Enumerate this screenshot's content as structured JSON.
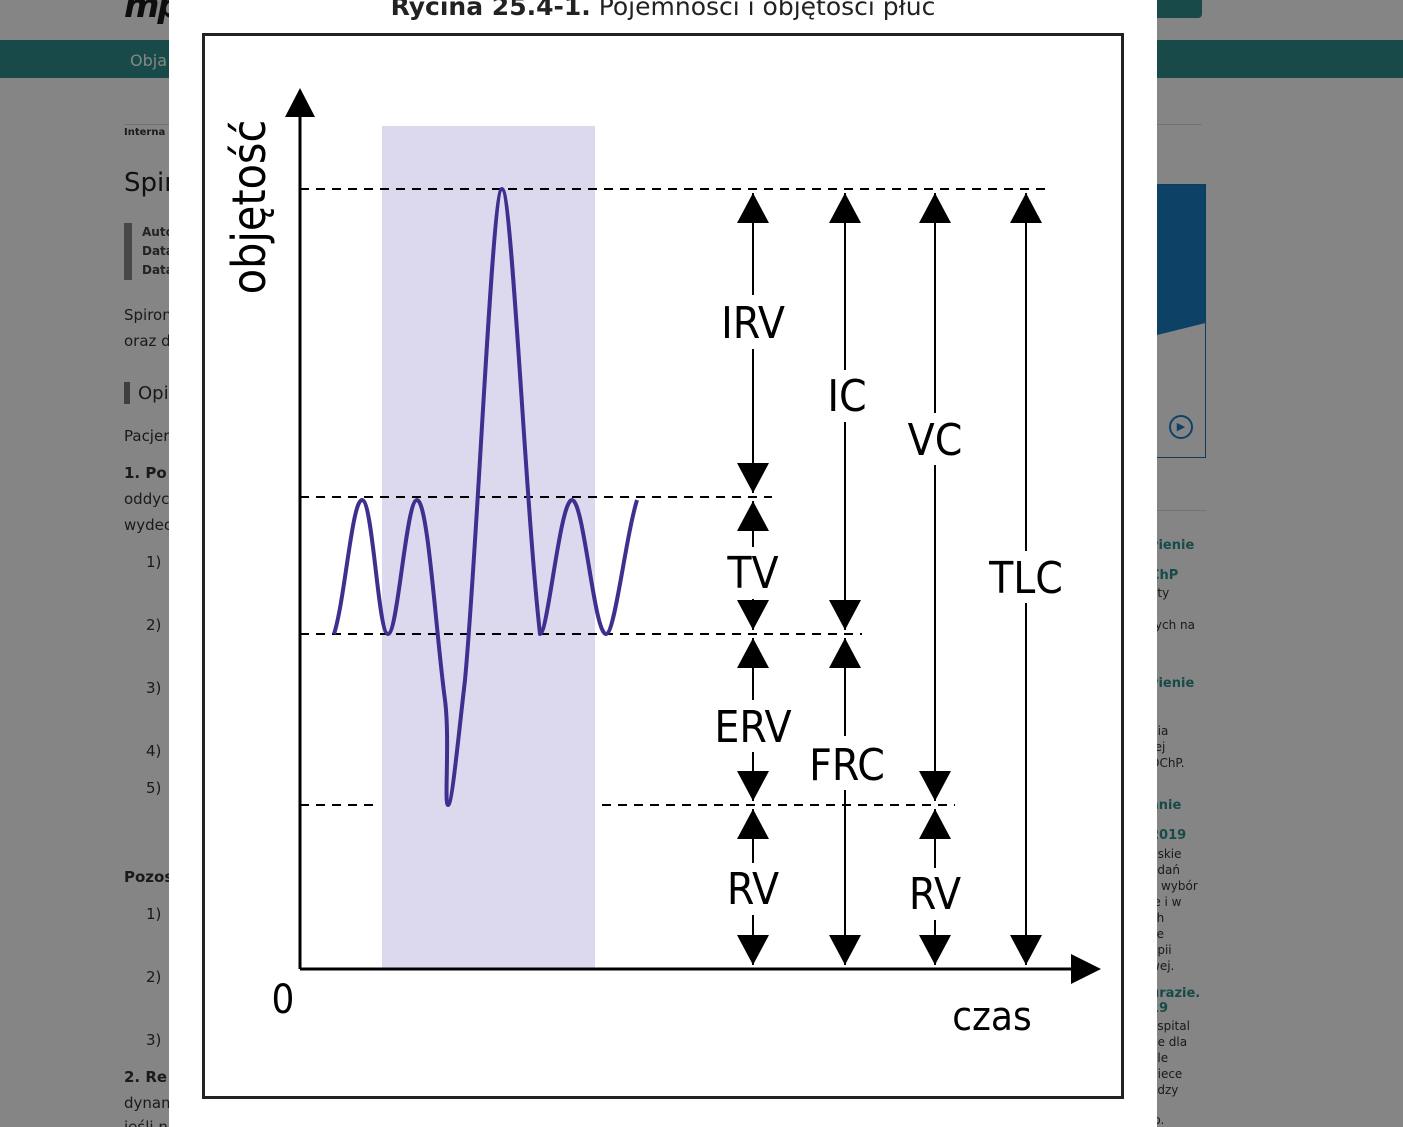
{
  "background_page": {
    "nav": {
      "item": "Obja"
    },
    "breadcrumb": "Interna",
    "title": "Spir",
    "meta": [
      "Auto",
      "Data",
      "Data"
    ],
    "intro_lines": [
      "Spiron",
      "oraz d"
    ],
    "section_heading": "Opi",
    "paragraph_start": "Pacjer",
    "point1": {
      "bold": "1. Po",
      "lines": [
        "oddyc",
        "wydec"
      ]
    },
    "list_a": [
      "1)",
      "2)",
      "3)",
      "4)",
      "5)"
    ],
    "subheading": "Pozos",
    "list_b": [
      "1)",
      "2)",
      "3)"
    ],
    "point2": {
      "bold": "2. Re",
      "line": "dynam",
      "cut": "jeśli n"
    },
    "sidebar": {
      "items": [
        {
          "type": "h",
          "text": "vienie"
        },
        {
          "type": "h",
          "text": "ChP"
        },
        {
          "type": "t",
          "text": "ety"
        },
        {
          "type": "t",
          "text": "rych na"
        },
        {
          "type": "h",
          "text": "vienie"
        },
        {
          "type": "t",
          "text": "nia"
        },
        {
          "type": "t",
          "text": "rej"
        },
        {
          "type": "t",
          "text": "OChP."
        },
        {
          "type": "h",
          "text": "anie"
        },
        {
          "type": "h",
          "text": "2019"
        },
        {
          "type": "t",
          "text": "ńskie"
        },
        {
          "type": "t",
          "text": "adań"
        },
        {
          "type": "t",
          "text": "i, wybór"
        },
        {
          "type": "t",
          "text": "ie i w"
        },
        {
          "type": "t",
          "text": "ch"
        },
        {
          "type": "t",
          "text": "ce"
        },
        {
          "type": "t",
          "text": "apii"
        },
        {
          "type": "t",
          "text": "wej."
        },
        {
          "type": "h",
          "text": "urazie."
        },
        {
          "type": "h",
          "text": "19"
        },
        {
          "type": "t",
          "text": "ospital"
        },
        {
          "type": "t",
          "text": "ne dla"
        },
        {
          "type": "t",
          "text": "ale"
        },
        {
          "type": "t",
          "text": "piece"
        },
        {
          "type": "t",
          "text": "ędzy"
        },
        {
          "type": "t",
          "text": "ło."
        }
      ]
    }
  },
  "lightbox": {
    "caption_number": "Rycina 25.4-1.",
    "caption_text": " Pojemności i objętości płuc"
  },
  "figure": {
    "y_axis_label": "objętość",
    "x_axis_label": "czas",
    "origin_label": "0",
    "volume_labels": {
      "irv": "IRV",
      "tv": "TV",
      "erv": "ERV",
      "rv": "RV",
      "ic": "IC",
      "frc": "FRC",
      "vc": "VC",
      "rv2": "RV",
      "tlc": "TLC"
    },
    "colors": {
      "trace": "#3f2f8f",
      "highlight": "#dcd9ee",
      "ink": "#000000"
    }
  }
}
